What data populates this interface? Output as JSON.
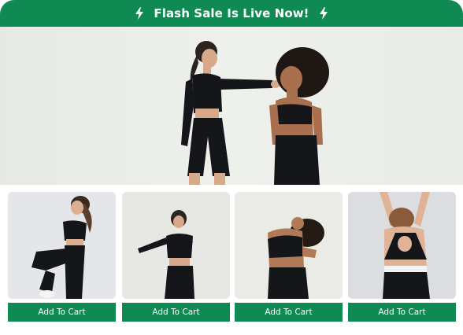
{
  "banner": {
    "text": "Flash Sale Is Live Now!",
    "icon": "lightning-bolt-icon",
    "background": "#0f8a52",
    "text_color": "#ffffff"
  },
  "hero": {
    "image": "two-models-in-black-activewear"
  },
  "products": [
    {
      "image": "model-black-leggings-high-knee",
      "button_label": "Add To Cart"
    },
    {
      "image": "model-black-long-sleeve-stretch",
      "button_label": "Add To Cart"
    },
    {
      "image": "model-black-sports-bra-arched",
      "button_label": "Add To Cart"
    },
    {
      "image": "model-open-back-sports-bra-rear",
      "button_label": "Add To Cart"
    }
  ],
  "colors": {
    "accent": "#0f8a52",
    "apparel": "#15161a",
    "skin": "#d9a98a"
  }
}
